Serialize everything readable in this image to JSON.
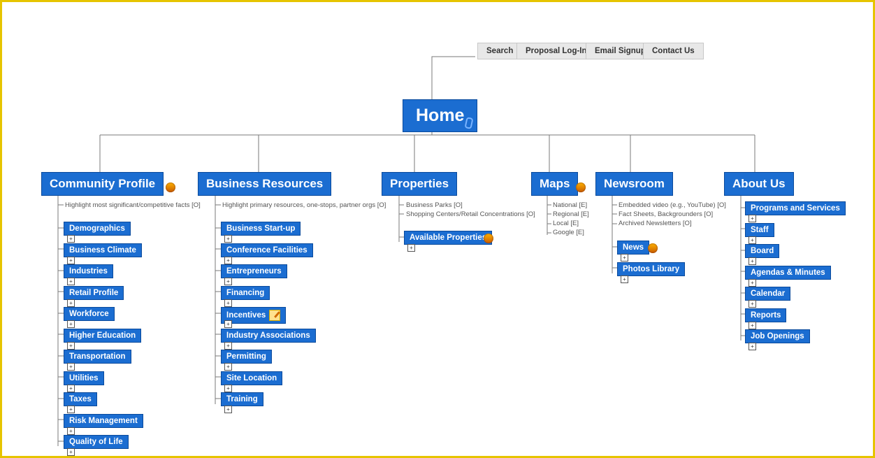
{
  "root": {
    "label": "Home"
  },
  "utilNav": {
    "search": "Search",
    "proposal": "Proposal Log-In",
    "email": "Email Signup",
    "contact": "Contact Us"
  },
  "categories": {
    "community": {
      "label": "Community Profile",
      "note": "Highlight most significant/competitive facts [O]"
    },
    "business": {
      "label": "Business Resources",
      "note": "Highlight primary resources, one-stops, partner orgs [O]"
    },
    "properties": {
      "label": "Properties",
      "note_a": "Business Parks [O]",
      "note_b": "Shopping Centers/Retail Concentrations [O]"
    },
    "maps": {
      "label": "Maps",
      "note_a": "National [E]",
      "note_b": "Regional [E]",
      "note_c": "Local [E]",
      "note_d": "Google [E]"
    },
    "newsroom": {
      "label": "Newsroom",
      "note_a": "Embedded video (e.g., YouTube) [O]",
      "note_b": "Fact Sheets, Backgrounders [O]",
      "note_c": "Archived Newsletters [O]"
    },
    "about": {
      "label": "About Us"
    }
  },
  "community_items": {
    "0": "Demographics",
    "1": "Business Climate",
    "2": "Industries",
    "3": "Retail Profile",
    "4": "Workforce",
    "5": "Higher Education",
    "6": "Transportation",
    "7": "Utilities",
    "8": "Taxes",
    "9": "Risk Management",
    "10": "Quality of Life"
  },
  "business_items": {
    "0": "Business Start-up",
    "1": "Conference Facilities",
    "2": "Entrepreneurs",
    "3": "Financing",
    "4": "Incentives",
    "5": "Industry Associations",
    "6": "Permitting",
    "7": "Site Location",
    "8": "Training"
  },
  "properties_items": {
    "0": "Available Properties"
  },
  "newsroom_items": {
    "0": "News",
    "1": "Photos Library"
  },
  "about_items": {
    "0": "Programs and Services",
    "1": "Staff",
    "2": "Board",
    "3": "Agendas & Minutes",
    "4": "Calendar",
    "5": "Reports",
    "6": "Job Openings"
  }
}
